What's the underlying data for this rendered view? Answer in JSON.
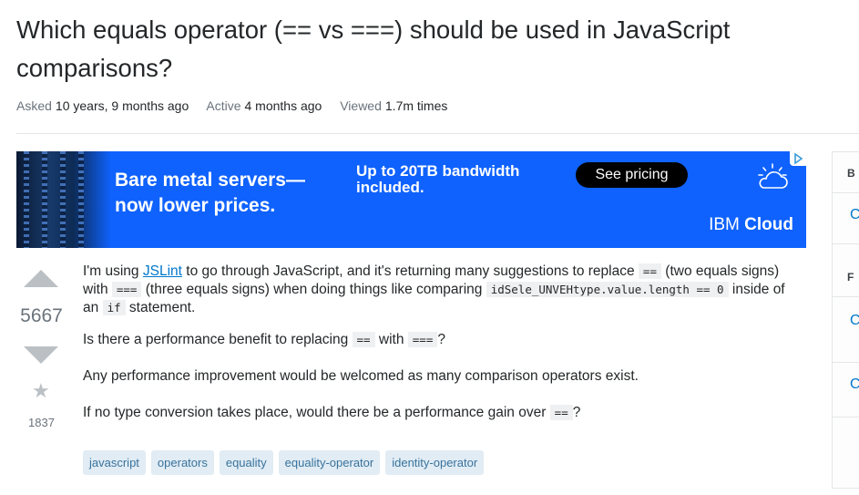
{
  "question": {
    "title": "Which equals operator (== vs ===) should be used in JavaScript comparisons?",
    "meta": [
      {
        "label": "Asked",
        "value": "10 years, 9 months ago"
      },
      {
        "label": "Active",
        "value": "4 months ago"
      },
      {
        "label": "Viewed",
        "value": "1.7m times"
      }
    ],
    "score": "5667",
    "favorites": "1837",
    "body": {
      "p1": {
        "t1": "I'm using ",
        "link": "JSLint",
        "t2": " to go through JavaScript, and it's returning many suggestions to replace ",
        "code1": "==",
        "t3": " (two equals signs) with ",
        "code2": "===",
        "t4": " (three equals signs) when doing things like comparing ",
        "code3": "idSele_UNVEHtype.value.length == 0",
        "t5": " inside of an ",
        "code4": "if",
        "t6": " statement."
      },
      "p2": {
        "t1": "Is there a performance benefit to replacing ",
        "code1": "==",
        "t2": " with ",
        "code2": "===",
        "t3": "?"
      },
      "p3": "Any performance improvement would be welcomed as many comparison operators exist.",
      "p4": {
        "t1": "If no type conversion takes place, would there be a performance gain over ",
        "code1": "==",
        "t2": "?"
      }
    },
    "tags": [
      "javascript",
      "operators",
      "equality",
      "equality-operator",
      "identity-operator"
    ]
  },
  "ad": {
    "headline": "Bare metal servers— now lower prices.",
    "subhead": "Up to 20TB bandwidth included.",
    "cta": "See pricing",
    "brand_light": "IBM",
    "brand_bold": "Cloud",
    "background_color": "#0f62fe"
  },
  "sidebar": {
    "visible_fragments": [
      "B",
      "C",
      "F",
      "C",
      "C"
    ]
  },
  "colors": {
    "link": "#0077cc",
    "tag_bg": "#e1ecf4",
    "tag_text": "#39739d",
    "vote_arrow": "#bbc0c4"
  }
}
